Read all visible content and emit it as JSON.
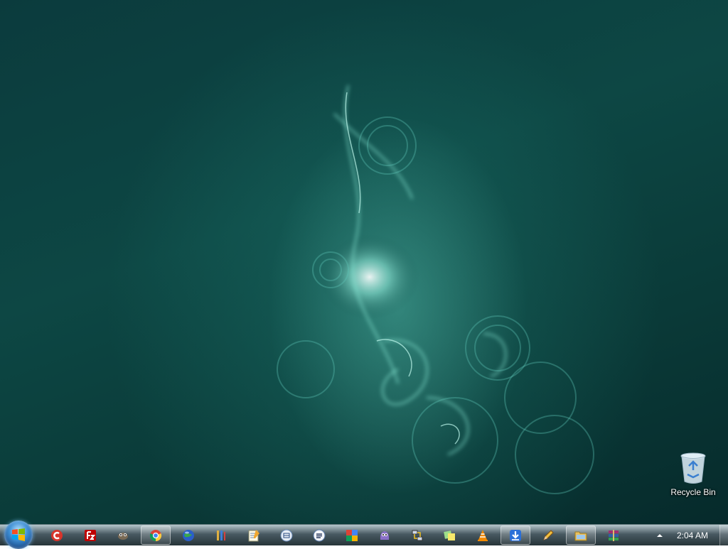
{
  "desktop": {
    "icons": [
      {
        "label": "Recycle Bin",
        "icon": "recycle-bin-icon"
      }
    ]
  },
  "taskbar": {
    "start_button": {
      "icon": "windows-logo-icon"
    },
    "pinned": [
      {
        "name": "ccleaner",
        "icon": "ccleaner-icon",
        "active": false
      },
      {
        "name": "filezilla",
        "icon": "filezilla-icon",
        "active": false
      },
      {
        "name": "gimp",
        "icon": "gimp-icon",
        "active": false
      },
      {
        "name": "chrome",
        "icon": "chrome-icon",
        "active": true
      },
      {
        "name": "google-earth",
        "icon": "globe-icon",
        "active": false
      },
      {
        "name": "paint-tool",
        "icon": "paint-brush-icon",
        "active": false
      },
      {
        "name": "notepad",
        "icon": "notepad-icon",
        "active": false
      },
      {
        "name": "media-app-1",
        "icon": "round-app-icon",
        "active": false
      },
      {
        "name": "media-app-2",
        "icon": "round-app-icon",
        "active": false
      },
      {
        "name": "picasa",
        "icon": "picasa-icon",
        "active": false
      },
      {
        "name": "pidgin",
        "icon": "pidgin-icon",
        "active": false
      },
      {
        "name": "network-tool",
        "icon": "network-icon",
        "active": false
      },
      {
        "name": "sticky-notes",
        "icon": "sticky-notes-icon",
        "active": false
      },
      {
        "name": "vlc",
        "icon": "vlc-cone-icon",
        "active": false
      },
      {
        "name": "download-manager",
        "icon": "download-arrow-icon",
        "active": true
      },
      {
        "name": "pencil-tool",
        "icon": "pencil-icon",
        "active": false
      },
      {
        "name": "windows-explorer",
        "icon": "folder-icon",
        "active": true
      },
      {
        "name": "winrar",
        "icon": "winrar-icon",
        "active": false
      }
    ],
    "tray": {
      "show_hidden_icon": "chevron-up-icon",
      "clock": "2:04 AM"
    }
  },
  "colors": {
    "wallpaper_base": "#0d4744",
    "wallpaper_glow": "#7de6d2",
    "taskbar": "#1c3036"
  }
}
